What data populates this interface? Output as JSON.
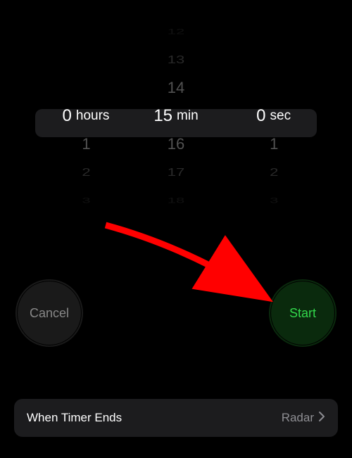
{
  "picker": {
    "hours": {
      "selected": "0",
      "unit": "hours",
      "below": [
        "1",
        "2",
        "3"
      ]
    },
    "minutes": {
      "above": [
        "12",
        "13",
        "14"
      ],
      "selected": "15",
      "unit": "min",
      "below": [
        "16",
        "17",
        "18"
      ]
    },
    "seconds": {
      "selected": "0",
      "unit": "sec",
      "below": [
        "1",
        "2",
        "3"
      ]
    }
  },
  "buttons": {
    "cancel": "Cancel",
    "start": "Start"
  },
  "when_timer_ends": {
    "label": "When Timer Ends",
    "value": "Radar"
  },
  "annotation": {
    "arrow_color": "#ff0000"
  }
}
